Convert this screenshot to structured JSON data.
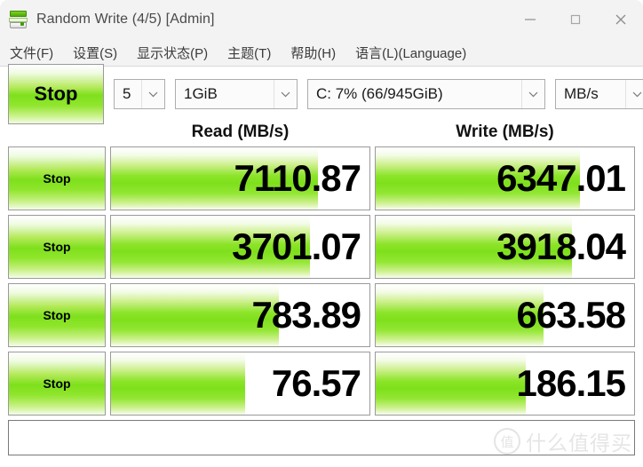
{
  "window": {
    "title": "Random Write (4/5) [Admin]",
    "icon": "crystaldiskmark-disk-icon",
    "controls": {
      "minimize": "minimize-icon",
      "maximize": "maximize-icon",
      "close": "close-icon"
    }
  },
  "menu": {
    "items": [
      {
        "label": "文件(F)"
      },
      {
        "label": "设置(S)"
      },
      {
        "label": "显示状态(P)"
      },
      {
        "label": "主题(T)"
      },
      {
        "label": "帮助(H)"
      },
      {
        "label": "语言(L)(Language)"
      }
    ]
  },
  "toolbar": {
    "all_button_label": "Stop",
    "count": "5",
    "size": "1GiB",
    "drive": "C: 7% (66/945GiB)",
    "unit": "MB/s",
    "arrow_icon": "chevron-down-icon"
  },
  "table": {
    "headers": [
      "Read (MB/s)",
      "Write (MB/s)"
    ],
    "rows": [
      {
        "button_label": "Stop",
        "read": "7110.87",
        "write": "6347.01",
        "read_fill_pct": 80,
        "write_fill_pct": 79
      },
      {
        "button_label": "Stop",
        "read": "3701.07",
        "write": "3918.04",
        "read_fill_pct": 77,
        "write_fill_pct": 76
      },
      {
        "button_label": "Stop",
        "read": "783.89",
        "write": "663.58",
        "read_fill_pct": 65,
        "write_fill_pct": 65
      },
      {
        "button_label": "Stop",
        "read": "76.57",
        "write": "186.15",
        "read_fill_pct": 52,
        "write_fill_pct": 58
      }
    ]
  },
  "comment": {
    "value": "",
    "placeholder": ""
  },
  "watermark": {
    "badge": "值",
    "text": "什么值得买"
  },
  "colors": {
    "accent_green": "#7ee01c",
    "window_chrome": "#f3f3f3",
    "title_text": "#4a4a4a",
    "border": "#9a9a9a"
  }
}
